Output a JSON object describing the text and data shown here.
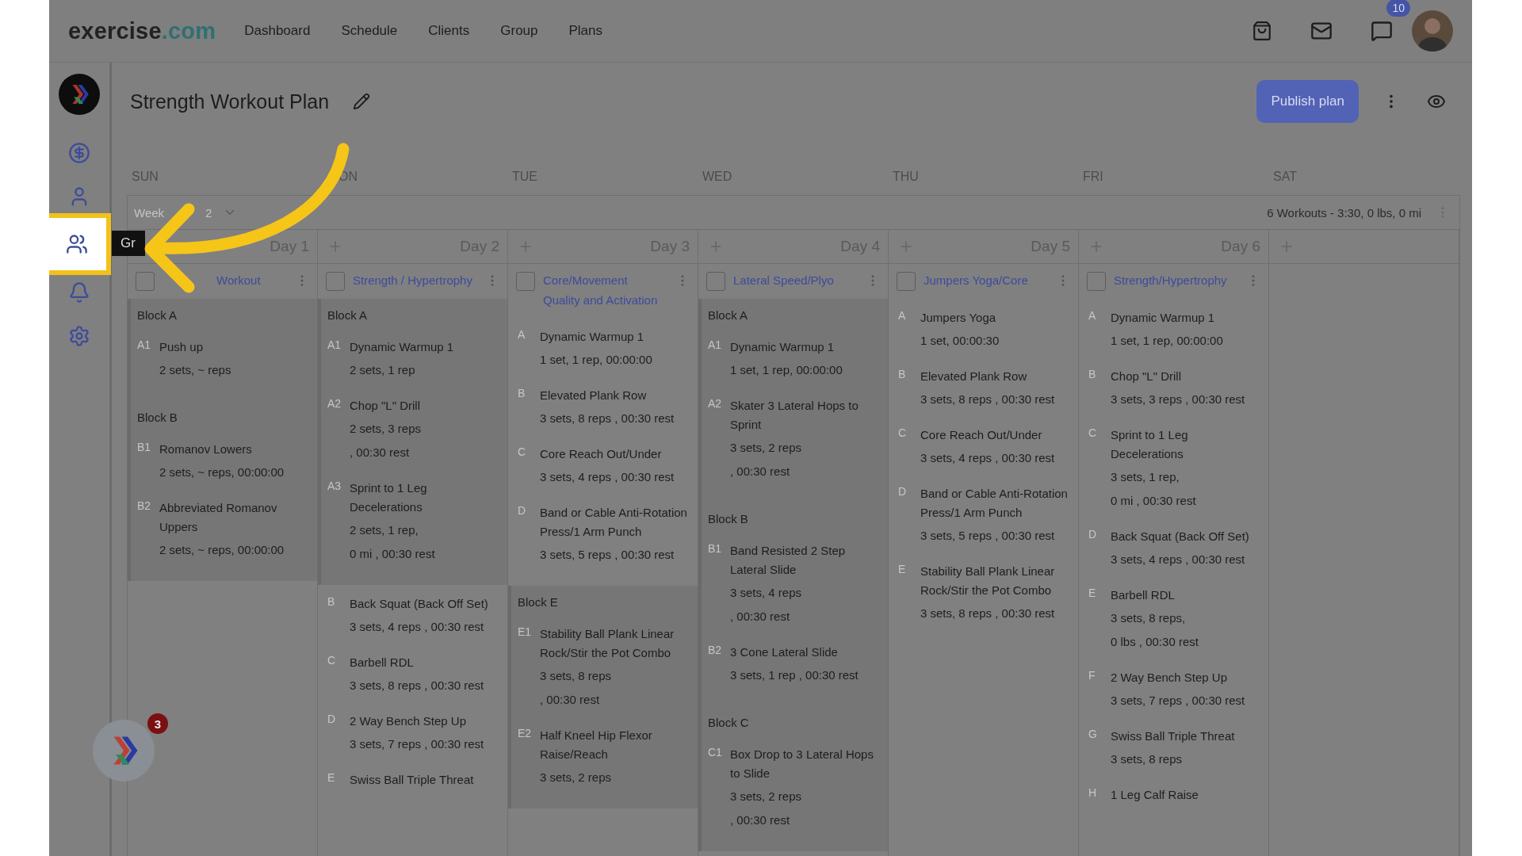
{
  "topbar": {
    "logo": {
      "text": "exercise",
      "accent": ".com"
    },
    "nav": [
      "Dashboard",
      "Schedule",
      "Clients",
      "Group",
      "Plans"
    ],
    "chat_badge": "10"
  },
  "sidebar": {
    "items": [
      {
        "kind": "dollar",
        "highlighted": false
      },
      {
        "kind": "user",
        "highlighted": false
      },
      {
        "kind": "group",
        "highlighted": true,
        "tooltip": "Gr"
      },
      {
        "kind": "bell",
        "highlighted": false
      },
      {
        "kind": "settings",
        "highlighted": false
      }
    ]
  },
  "plan": {
    "title": "Strength Workout Plan",
    "publish_button": "Publish plan"
  },
  "weekdays": [
    "SUN",
    "ON",
    "TUE",
    "WED",
    "THU",
    "FRI",
    "SAT"
  ],
  "week_bar": {
    "label": "Week",
    "range_end": "2",
    "summary": "6 Workouts - 3:30, 0 lbs, 0 mi"
  },
  "columns": [
    {
      "day": "Day 1",
      "add": false,
      "title": "Workout",
      "checked": false,
      "sections": [
        {
          "kind": "block",
          "title": "Block A",
          "exercises": [
            {
              "code": "A1",
              "name": "Push up",
              "details": [
                "2 sets, ~ reps"
              ]
            }
          ]
        },
        {
          "kind": "block",
          "title": "Block B",
          "exercises": [
            {
              "code": "B1",
              "name": "Romanov Lowers",
              "details": [
                "2 sets, ~ reps, 00:00:00"
              ]
            },
            {
              "code": "B2",
              "name": "Abbreviated Romanov Uppers",
              "details": [
                "2 sets, ~ reps, 00:00:00"
              ]
            }
          ]
        }
      ]
    },
    {
      "day": "Day 2",
      "add": true,
      "title": "Strength / Hypertrophy",
      "checked": false,
      "sections": [
        {
          "kind": "block",
          "title": "Block A",
          "exercises": [
            {
              "code": "A1",
              "name": "Dynamic Warmup 1",
              "details": [
                "2 sets, 1 rep"
              ]
            },
            {
              "code": "A2",
              "name": "Chop \"L\" Drill",
              "details": [
                "2 sets, 3 reps",
                ", 00:30 rest"
              ]
            },
            {
              "code": "A3",
              "name": "Sprint to 1 Leg Decelerations",
              "details": [
                "2 sets, 1 rep,",
                "0 mi , 00:30 rest"
              ]
            }
          ]
        },
        {
          "kind": "single",
          "exercises": [
            {
              "code": "B",
              "name": "Back Squat (Back Off Set)",
              "details": [
                "3 sets, 4 reps , 00:30 rest"
              ]
            },
            {
              "code": "C",
              "name": "Barbell RDL",
              "details": [
                "3 sets, 8 reps , 00:30 rest"
              ]
            },
            {
              "code": "D",
              "name": "2 Way Bench Step Up",
              "details": [
                "3 sets, 7 reps , 00:30 rest"
              ]
            },
            {
              "code": "E",
              "name": "Swiss Ball Triple Threat"
            }
          ]
        }
      ]
    },
    {
      "day": "Day 3",
      "add": true,
      "title": "Core/Movement Quality and Activation",
      "checked": false,
      "sections": [
        {
          "kind": "single",
          "exercises": [
            {
              "code": "A",
              "name": "Dynamic Warmup 1",
              "details": [
                "1 set, 1 rep, 00:00:00"
              ]
            },
            {
              "code": "B",
              "name": "Elevated Plank Row",
              "details": [
                "3 sets, 8 reps , 00:30 rest"
              ]
            },
            {
              "code": "C",
              "name": "Core Reach Out/Under",
              "details": [
                "3 sets, 4 reps , 00:30 rest"
              ]
            },
            {
              "code": "D",
              "name": "Band or Cable Anti-Rotation Press/1 Arm Punch",
              "details": [
                "3 sets, 5 reps , 00:30 rest"
              ]
            }
          ]
        },
        {
          "kind": "block",
          "title": "Block E",
          "exercises": [
            {
              "code": "E1",
              "name": "Stability Ball Plank Linear Rock/Stir the Pot Combo",
              "details": [
                "3 sets, 8 reps",
                ", 00:30 rest"
              ]
            },
            {
              "code": "E2",
              "name": "Half Kneel Hip Flexor Raise/Reach",
              "details": [
                "3 sets, 2 reps"
              ]
            }
          ]
        }
      ]
    },
    {
      "day": "Day 4",
      "add": true,
      "title": "Lateral Speed/Plyo",
      "checked": false,
      "sections": [
        {
          "kind": "block",
          "title": "Block A",
          "exercises": [
            {
              "code": "A1",
              "name": "Dynamic Warmup 1",
              "details": [
                "1 set, 1 rep, 00:00:00"
              ]
            },
            {
              "code": "A2",
              "name": "Skater 3 Lateral Hops to Sprint",
              "details": [
                "3 sets, 2 reps",
                ", 00:30 rest"
              ]
            }
          ]
        },
        {
          "kind": "block",
          "title": "Block B",
          "exercises": [
            {
              "code": "B1",
              "name": "Band Resisted 2 Step Lateral Slide",
              "details": [
                "3 sets, 4 reps",
                ", 00:30 rest"
              ]
            },
            {
              "code": "B2",
              "name": "3 Cone Lateral Slide",
              "details": [
                "3 sets, 1 rep , 00:30 rest"
              ]
            }
          ]
        },
        {
          "kind": "block",
          "title": "Block C",
          "exercises": [
            {
              "code": "C1",
              "name": "Box Drop to 3 Lateral Hops to Slide",
              "details": [
                "3 sets, 2 reps",
                ", 00:30 rest"
              ]
            }
          ]
        }
      ]
    },
    {
      "day": "Day 5",
      "add": true,
      "title": "Jumpers Yoga/Core",
      "checked": false,
      "sections": [
        {
          "kind": "single",
          "exercises": [
            {
              "code": "A",
              "name": "Jumpers Yoga",
              "details": [
                "1 set, 00:00:30"
              ]
            },
            {
              "code": "B",
              "name": "Elevated Plank Row",
              "details": [
                "3 sets, 8 reps , 00:30 rest"
              ]
            },
            {
              "code": "C",
              "name": "Core Reach Out/Under",
              "details": [
                "3 sets, 4 reps , 00:30 rest"
              ]
            },
            {
              "code": "D",
              "name": "Band or Cable Anti-Rotation Press/1 Arm Punch",
              "details": [
                "3 sets, 5 reps , 00:30 rest"
              ]
            },
            {
              "code": "E",
              "name": "Stability Ball Plank Linear Rock/Stir the Pot Combo",
              "details": [
                "3 sets, 8 reps , 00:30 rest"
              ]
            }
          ]
        }
      ]
    },
    {
      "day": "Day 6",
      "add": true,
      "title": "Strength/Hypertrophy",
      "checked": false,
      "sections": [
        {
          "kind": "single",
          "exercises": [
            {
              "code": "A",
              "name": "Dynamic Warmup 1",
              "details": [
                "1 set, 1 rep, 00:00:00"
              ]
            },
            {
              "code": "B",
              "name": "Chop \"L\" Drill",
              "details": [
                "3 sets, 3 reps , 00:30 rest"
              ]
            },
            {
              "code": "C",
              "name": "Sprint to 1 Leg Decelerations",
              "details": [
                "3 sets, 1 rep,",
                "0 mi , 00:30 rest"
              ]
            },
            {
              "code": "D",
              "name": "Back Squat (Back Off Set)",
              "details": [
                "3 sets, 4 reps , 00:30 rest"
              ]
            },
            {
              "code": "E",
              "name": "Barbell RDL",
              "details": [
                "3 sets, 8 reps,",
                "0 lbs , 00:30 rest"
              ]
            },
            {
              "code": "F",
              "name": "2 Way Bench Step Up",
              "details": [
                "3 sets, 7 reps , 00:30 rest"
              ]
            },
            {
              "code": "G",
              "name": "Swiss Ball Triple Threat",
              "details": [
                "3 sets, 8 reps"
              ]
            },
            {
              "code": "H",
              "name": "1 Leg Calf Raise"
            }
          ]
        }
      ]
    },
    {
      "add": true
    }
  ],
  "assistant_badge": "3"
}
